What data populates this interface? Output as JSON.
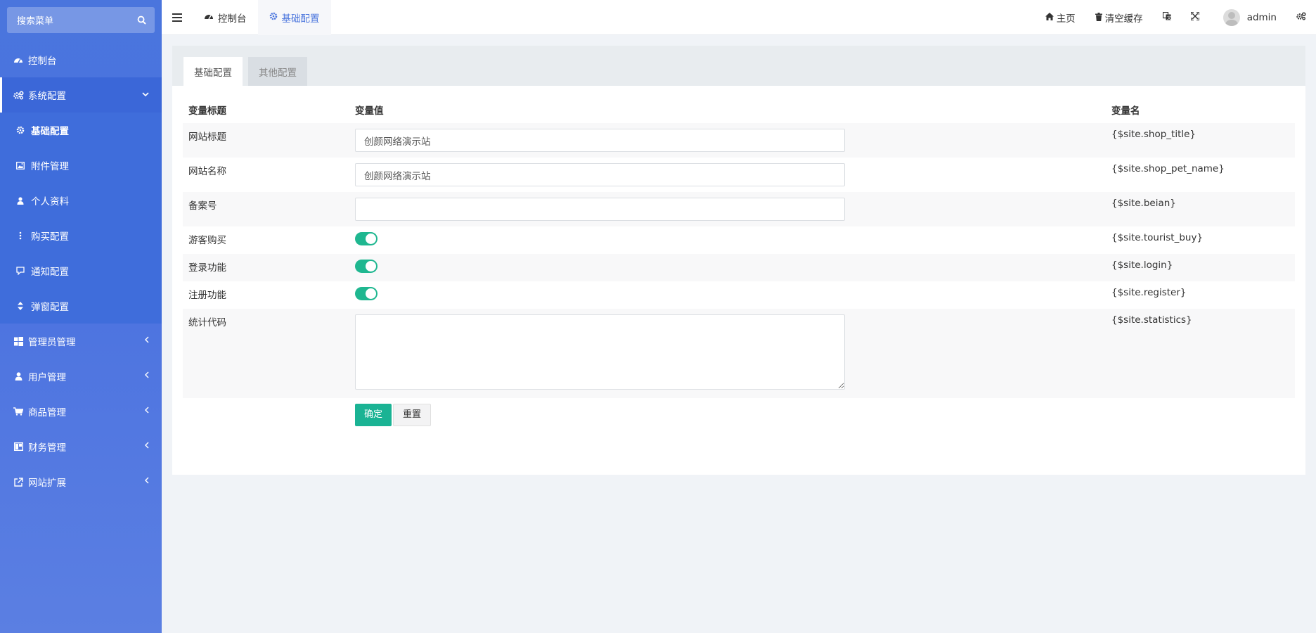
{
  "sidebar": {
    "search_label": "搜索菜单",
    "items": [
      {
        "label": "控制台",
        "icon": "dashboard-icon"
      },
      {
        "label": "系统配置",
        "icon": "cogs-icon",
        "open": true
      },
      {
        "label": "管理员管理",
        "icon": "windows-icon"
      },
      {
        "label": "用户管理",
        "icon": "user-icon"
      },
      {
        "label": "商品管理",
        "icon": "cart-icon"
      },
      {
        "label": "财务管理",
        "icon": "columns-icon"
      },
      {
        "label": "网站扩展",
        "icon": "external-link-icon"
      }
    ],
    "submenu": [
      {
        "label": "基础配置",
        "icon": "gear-icon",
        "active": true
      },
      {
        "label": "附件管理",
        "icon": "image-icon"
      },
      {
        "label": "个人资料",
        "icon": "user-icon"
      },
      {
        "label": "购买配置",
        "icon": "ellipsis-vertical-icon"
      },
      {
        "label": "通知配置",
        "icon": "message-icon"
      },
      {
        "label": "弹窗配置",
        "icon": "sort-icon"
      }
    ]
  },
  "header": {
    "tabs": [
      {
        "label": "控制台",
        "icon": "dashboard-icon"
      },
      {
        "label": "基础配置",
        "icon": "gear-icon",
        "active": true
      }
    ],
    "home_label": "主页",
    "clear_cache_label": "清空缓存",
    "user_name": "admin"
  },
  "panel": {
    "tabs": [
      "基础配置",
      "其他配置"
    ],
    "columns": [
      "变量标题",
      "变量值",
      "变量名"
    ],
    "rows": [
      {
        "title": "网站标题",
        "type": "input",
        "value": "创颜网络演示站",
        "var": "{$site.shop_title}"
      },
      {
        "title": "网站名称",
        "type": "input",
        "value": "创颜网络演示站",
        "var": "{$site.shop_pet_name}"
      },
      {
        "title": "备案号",
        "type": "input",
        "value": "",
        "var": "{$site.beian}"
      },
      {
        "title": "游客购买",
        "type": "switch",
        "value": "on",
        "var": "{$site.tourist_buy}"
      },
      {
        "title": "登录功能",
        "type": "switch",
        "value": "on",
        "var": "{$site.login}"
      },
      {
        "title": "注册功能",
        "type": "switch",
        "value": "on",
        "var": "{$site.register}"
      },
      {
        "title": "统计代码",
        "type": "textarea",
        "value": "",
        "var": "{$site.statistics}"
      }
    ],
    "confirm_label": "确定",
    "reset_label": "重置"
  },
  "colors": {
    "sidebar": "#4a75dd",
    "accent": "#1ab394",
    "active_tab_text": "#4a75dd"
  }
}
